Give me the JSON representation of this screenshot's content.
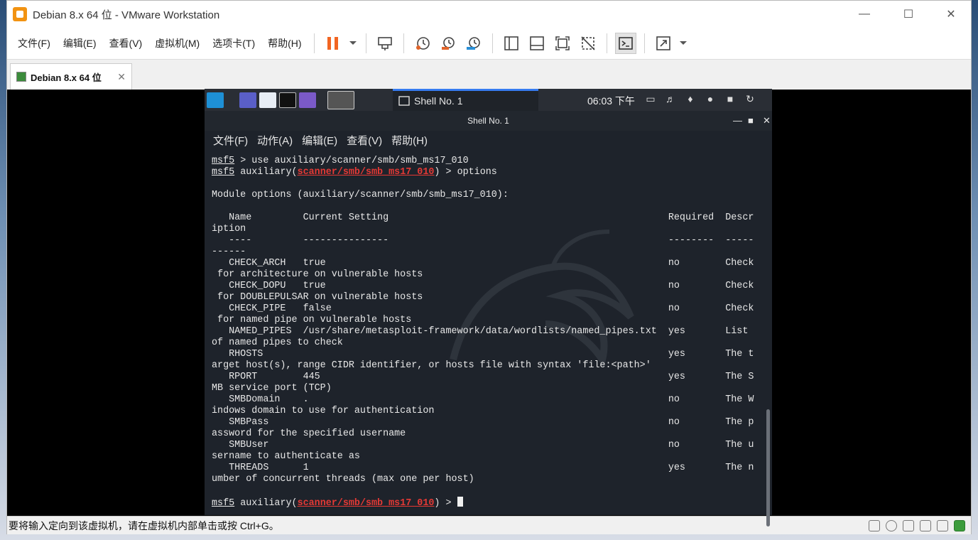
{
  "window": {
    "title": "Debian 8.x 64 位 - VMware Workstation"
  },
  "menu": [
    "文件(F)",
    "编辑(E)",
    "查看(V)",
    "虚拟机(M)",
    "选项卡(T)",
    "帮助(H)"
  ],
  "tab": {
    "label": "Debian 8.x 64 位"
  },
  "kali": {
    "taskbar_label": "Shell No. 1",
    "clock": "06:03 下午",
    "window_title": "Shell No. 1",
    "menu": [
      "文件(F)",
      "动作(A)",
      "编辑(E)",
      "查看(V)",
      "帮助(H)"
    ]
  },
  "terminal": {
    "prompt": "msf5",
    "module": "scanner/smb/smb_ms17_010",
    "lines": [
      {
        "type": "cmd1",
        "text": " > use auxiliary/scanner/smb/smb_ms17_010"
      },
      {
        "type": "cmd2",
        "text": ") > options"
      },
      {
        "type": "blank",
        "text": ""
      },
      {
        "type": "out",
        "text": "Module options (auxiliary/scanner/smb/smb_ms17_010):"
      },
      {
        "type": "blank",
        "text": ""
      },
      {
        "type": "out",
        "text": "   Name         Current Setting                                                 Required  Descr"
      },
      {
        "type": "out",
        "text": "iption"
      },
      {
        "type": "out",
        "text": "   ----         ---------------                                                 --------  -----"
      },
      {
        "type": "out",
        "text": "------"
      },
      {
        "type": "out",
        "text": "   CHECK_ARCH   true                                                            no        Check"
      },
      {
        "type": "out",
        "text": " for architecture on vulnerable hosts"
      },
      {
        "type": "out",
        "text": "   CHECK_DOPU   true                                                            no        Check"
      },
      {
        "type": "out",
        "text": " for DOUBLEPULSAR on vulnerable hosts"
      },
      {
        "type": "out",
        "text": "   CHECK_PIPE   false                                                           no        Check"
      },
      {
        "type": "out",
        "text": " for named pipe on vulnerable hosts"
      },
      {
        "type": "out",
        "text": "   NAMED_PIPES  /usr/share/metasploit-framework/data/wordlists/named_pipes.txt  yes       List"
      },
      {
        "type": "out",
        "text": "of named pipes to check"
      },
      {
        "type": "out",
        "text": "   RHOSTS                                                                       yes       The t"
      },
      {
        "type": "out",
        "text": "arget host(s), range CIDR identifier, or hosts file with syntax 'file:<path>'"
      },
      {
        "type": "out",
        "text": "   RPORT        445                                                             yes       The S"
      },
      {
        "type": "out",
        "text": "MB service port (TCP)"
      },
      {
        "type": "out",
        "text": "   SMBDomain    .                                                               no        The W"
      },
      {
        "type": "out",
        "text": "indows domain to use for authentication"
      },
      {
        "type": "out",
        "text": "   SMBPass                                                                      no        The p"
      },
      {
        "type": "out",
        "text": "assword for the specified username"
      },
      {
        "type": "out",
        "text": "   SMBUser                                                                      no        The u"
      },
      {
        "type": "out",
        "text": "sername to authenticate as"
      },
      {
        "type": "out",
        "text": "   THREADS      1                                                               yes       The n"
      },
      {
        "type": "out",
        "text": "umber of concurrent threads (max one per host)"
      },
      {
        "type": "blank",
        "text": ""
      },
      {
        "type": "cmd3",
        "text": ") > "
      }
    ],
    "auxiliary_prefix": " auxiliary(",
    "cmd_use": " > use auxiliary/scanner/smb/smb_ms17_010",
    "cmd_options": ") > options",
    "cmd_end": ") > "
  },
  "status": {
    "text": "要将输入定向到该虚拟机，请在虚拟机内部单击或按 Ctrl+G。"
  },
  "colors": {
    "accent": "#367bf0",
    "prompt_module": "#e53935",
    "pause": "#f26522"
  }
}
